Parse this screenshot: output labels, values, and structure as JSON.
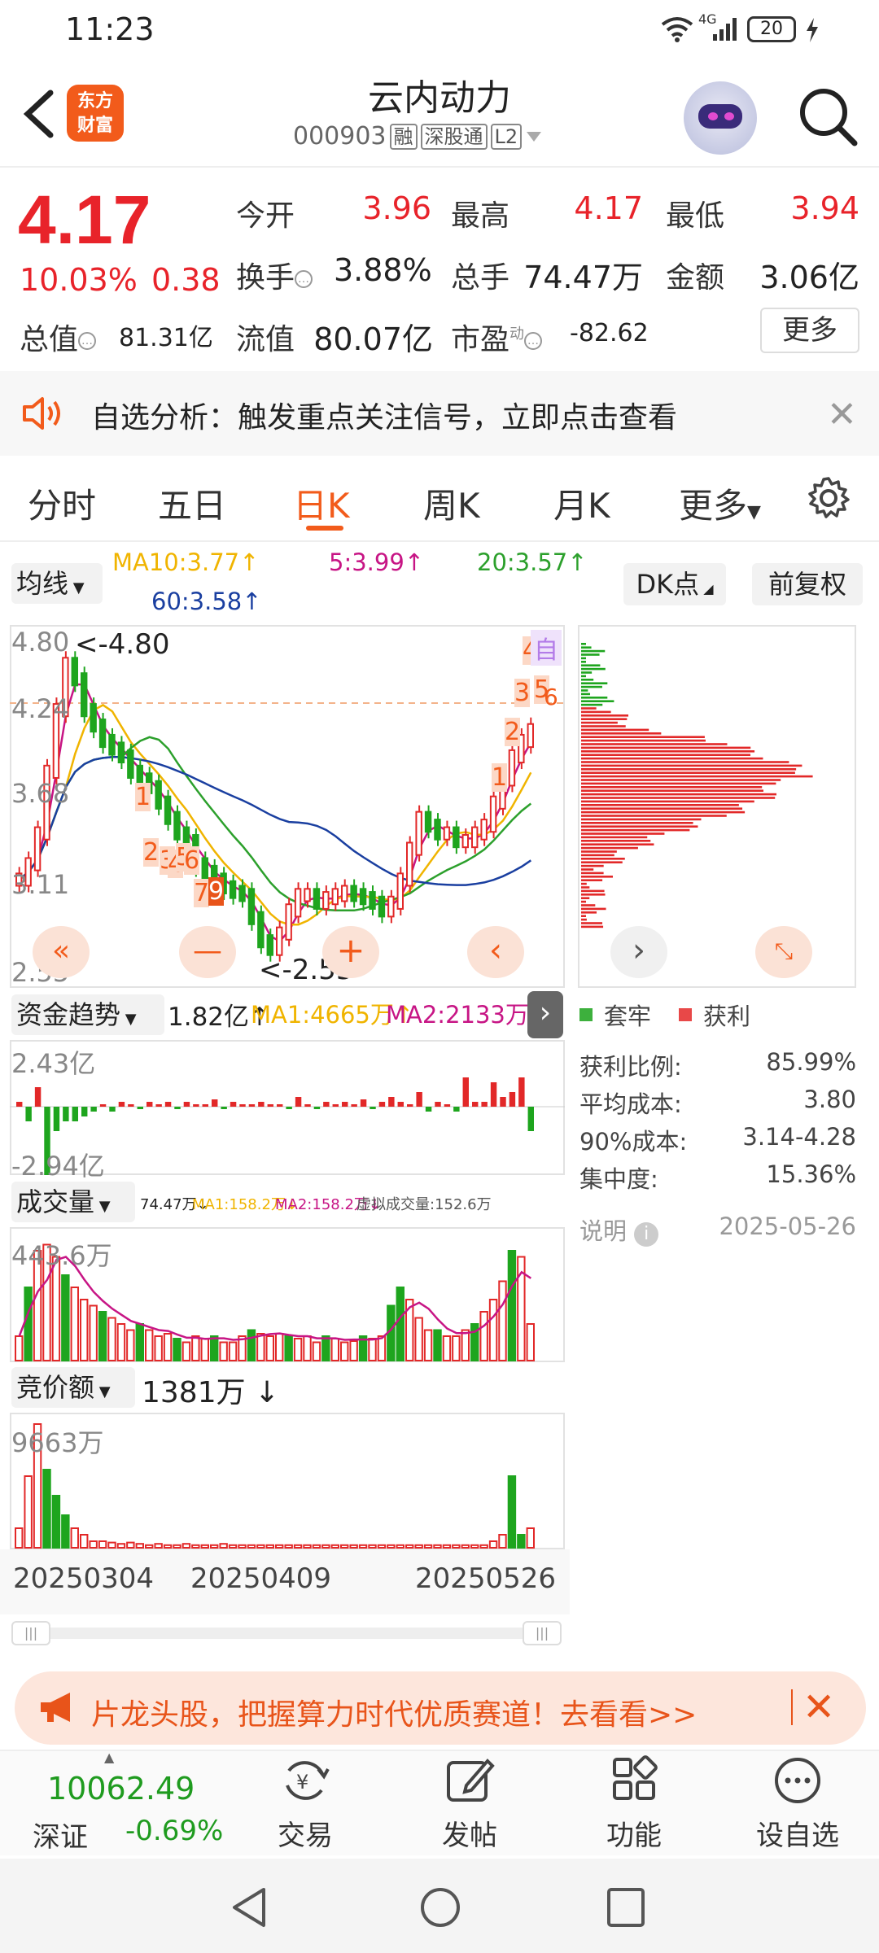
{
  "status": {
    "time": "11:23",
    "network": "4G",
    "battery": "20"
  },
  "header": {
    "logo_line1": "东方",
    "logo_line2": "财富",
    "stock_name": "云内动力",
    "stock_code": "000903",
    "tags": [
      "融",
      "深股通",
      "L2"
    ]
  },
  "quote": {
    "price": "4.17",
    "change_pct": "10.03%",
    "change": "0.38",
    "open_label": "今开",
    "open": "3.96",
    "high_label": "最高",
    "high": "4.17",
    "low_label": "最低",
    "low": "3.94",
    "turnover_label": "换手",
    "turnover": "3.88%",
    "volume_label": "总手",
    "volume": "74.47万",
    "amount_label": "金额",
    "amount": "3.06亿",
    "mktcap_label": "总值",
    "mktcap": "81.31亿",
    "float_label": "流值",
    "float_cap": "80.07亿",
    "pe_label": "市盈",
    "pe_sup": "动",
    "pe": "-82.62",
    "more": "更多"
  },
  "notice": {
    "text": "自选分析：触发重点关注信号，立即点击查看"
  },
  "tabs": [
    "分时",
    "五日",
    "日K",
    "周K",
    "月K",
    "更多"
  ],
  "active_tab": "日K",
  "ma": {
    "selector": "均线",
    "ma10": "MA10:3.77↑",
    "ma5": "5:3.99↑",
    "ma20": "20:3.57↑",
    "ma60": "60:3.58↑",
    "dk": "DK点",
    "adjust": "前复权",
    "colors": {
      "ma5": "#c71585",
      "ma10": "#f0b400",
      "ma20": "#2ca02c",
      "ma60": "#1a3fa0"
    }
  },
  "kline": {
    "y_high": "4.80",
    "y_2": "4.24",
    "y_3": "3.68",
    "y_low": "3.11",
    "y_min": "2.55",
    "max_marker": "<-4.80",
    "min_marker": "<-2.55",
    "signals_left": [
      "1",
      "2",
      "3",
      "4",
      "5",
      "6",
      "7",
      "9"
    ],
    "signals_right": [
      "1",
      "2",
      "3",
      "4",
      "5",
      "6"
    ],
    "self_tag": "自"
  },
  "fund": {
    "selector": "资金趋势",
    "value": "1.82亿↑",
    "ma1": "MA1:4665万↑",
    "ma2": "MA2:2133万↑",
    "y_top": "2.43亿",
    "y_bottom": "-2.94亿"
  },
  "volume": {
    "selector": "成交量",
    "value": "74.47万↓",
    "ma1": "MA1:158.2万↓",
    "ma2": "MA2:158.2万↓",
    "virtual": "虚拟成交量:152.6万",
    "y_top": "443.6万"
  },
  "bid": {
    "selector": "竞价额",
    "value": "1381万 ↓",
    "y_top": "9663万"
  },
  "dates": [
    "20250304",
    "20250409",
    "20250526"
  ],
  "chips": {
    "legend_trapped": "套牢",
    "legend_profit": "获利",
    "rows": [
      {
        "label": "获利比例:",
        "value": "85.99%"
      },
      {
        "label": "平均成本:",
        "value": "3.80"
      },
      {
        "label": "90%成本:",
        "value": "3.14-4.28"
      },
      {
        "label": "集中度:",
        "value": "15.36%"
      }
    ],
    "note": "说明",
    "date": "2025-05-26"
  },
  "banner": {
    "text": "片龙头股，把握算力时代优质赛道！去看看>>"
  },
  "bottom": {
    "index_value": "10062.49",
    "index_name": "深证",
    "index_change": "-0.69%",
    "nav": [
      "交易",
      "发帖",
      "功能",
      "设自选"
    ]
  }
}
